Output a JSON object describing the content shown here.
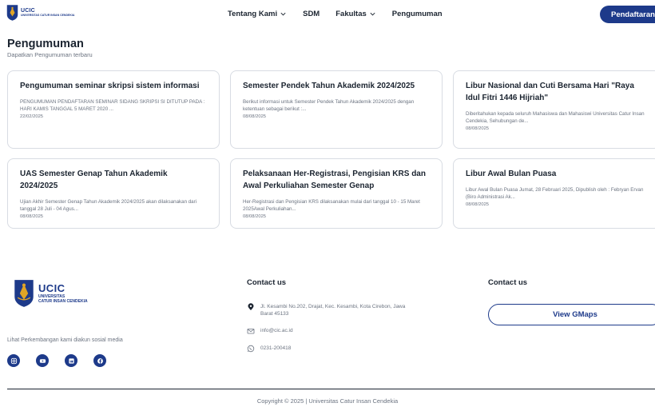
{
  "header": {
    "logo_text": "UCIC",
    "logo_sub": "UNIVERSITAS CATUR INSAN CENDEKIA",
    "nav": [
      {
        "label": "Tentang Kami",
        "has_dropdown": true
      },
      {
        "label": "SDM",
        "has_dropdown": false
      },
      {
        "label": "Fakultas",
        "has_dropdown": true
      },
      {
        "label": "Pengumuman",
        "has_dropdown": false
      }
    ],
    "cta_label": "Pendaftaran"
  },
  "page": {
    "title": "Pengumuman",
    "subtitle": "Dapatkan Pengumuman terbaru"
  },
  "cards": [
    {
      "title": "Pengumuman seminar skripsi sistem informasi",
      "desc": "PENGUMUMAN   PENDAFTARAN SEMINAR SIDANG SKRIPSI SI DITUTUP PADA : HARI KAMIS TANGGAL 5 MARET 2020  ...",
      "date": "22/02/2025"
    },
    {
      "title": "Semester Pendek Tahun Akademik 2024/2025",
      "desc": "Berikut informasi untuk Semester Pendek Tahun Akademik 2024/2025 dengan ketentuan sebagai berikut :...",
      "date": "08/08/2025"
    },
    {
      "title": "Libur Nasional dan Cuti Bersama Hari \"Raya Idul Fitri 1446 Hijriah\"",
      "desc": "Diberitahukan kepada seluruh Mahasiswa dan Mahasiswi Universitas Catur Insan Cendekia, Sehubungan de...",
      "date": "08/08/2025"
    },
    {
      "title": "UAS Semester Genap Tahun Akademik 2024/2025",
      "desc": "Ujian Akhir Semester Genap Tahun Akademik 2024/2025 akan dilaksanakan dari tanggal 28 Juli - 04 Agus...",
      "date": "08/08/2025"
    },
    {
      "title": "Pelaksanaan Her-Registrasi, Pengisian KRS dan Awal Perkuliahan Semester Genap",
      "desc": "Her-Registrasi dan Pengisian KRS dilaksanakan mulai dari tanggal 10 - 15 Maret 2025Awal Perkuliahan...",
      "date": "08/08/2025"
    },
    {
      "title": "Libur Awal Bulan Puasa",
      "desc": "Libur Awal Bulan Puasa Jumat, 28 Februari 2025, Dipublish oleh : Febryan Ervan (Biro Administrasi Ak...",
      "date": "08/08/2025"
    }
  ],
  "footer": {
    "logo_text": "UCIC",
    "logo_sub1": "UNIVERSITAS",
    "logo_sub2": "CATUR INSAN CENDEKIA",
    "social_text": "Lihat Perkembangan kami diakun sosial media",
    "socials": [
      "instagram-icon",
      "youtube-icon",
      "linkedin-icon",
      "facebook-icon"
    ],
    "contact_heading_1": "Contact us",
    "contact_heading_2": "Contact us",
    "address": "Jl. Kesambi No.202, Drajat, Kec. Kesambi, Kota Cirebon, Jawa Barat 45133",
    "email": "info@cic.ac.id",
    "phone": "0231-200418",
    "gmaps_label": "View GMaps",
    "copyright": "Copyright © 2025 | Universitas Catur Insan Cendekia"
  },
  "colors": {
    "brand": "#1d3a8a",
    "accent_gold": "#e0a526",
    "text": "#1b2430",
    "muted": "#6b7380"
  }
}
